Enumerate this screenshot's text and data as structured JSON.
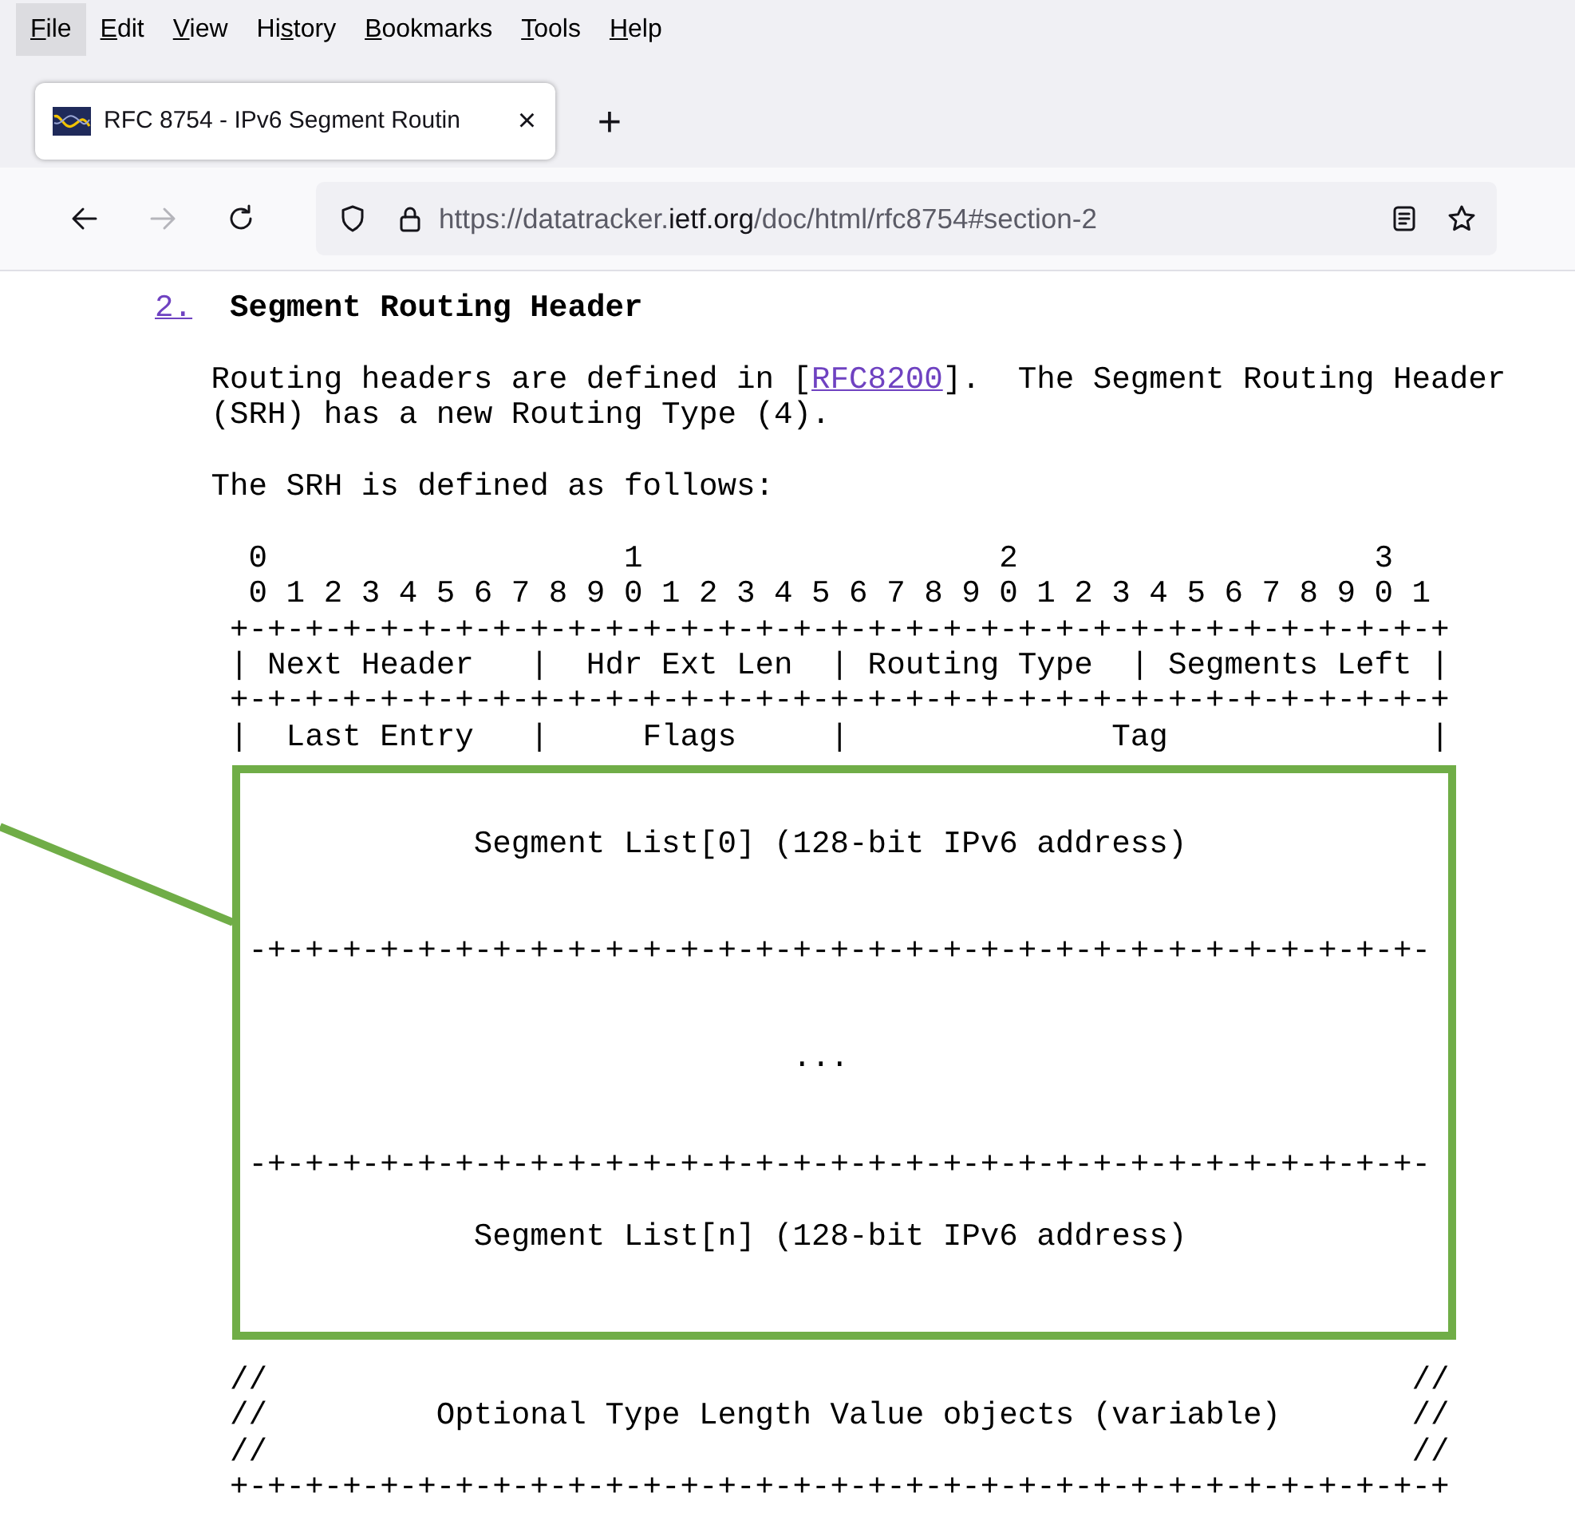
{
  "menu_bar": [
    {
      "key": "F",
      "after": "ile",
      "selected": true
    },
    {
      "key": "E",
      "after": "dit",
      "selected": false
    },
    {
      "key": "V",
      "after": "iew",
      "selected": false
    },
    {
      "before": "Hi",
      "key": "s",
      "after": "tory",
      "selected": false
    },
    {
      "key": "B",
      "after": "ookmarks",
      "selected": false
    },
    {
      "key": "T",
      "after": "ools",
      "selected": false
    },
    {
      "key": "H",
      "after": "elp",
      "selected": false
    }
  ],
  "tabs": [
    {
      "title": "RFC 8754 - IPv6 Segment Routin",
      "close": "×",
      "selected": true
    }
  ],
  "new_tab": "+",
  "nav": {
    "back_disabled": false,
    "forward_disabled": true,
    "url": {
      "prefix": "https://datatracker.",
      "domain": "ietf.org",
      "path": "/doc/html/rfc8754#section-2"
    }
  },
  "section": {
    "number": "2.",
    "title": "Segment Routing Header",
    "paragraphs": [
      {
        "lines": [
          {
            "before": "Routing headers are defined in [",
            "link": "RFC8200",
            "after": "].  The Segment Routing Header"
          },
          {
            "before": "(SRH) has a new Routing Type (4)."
          }
        ]
      },
      {
        "lines": [
          {
            "before": "The SRH is defined as follows:"
          }
        ]
      }
    ],
    "diagram": {
      "lines": [
        {
          "kind": "text",
          "text": " 0                   1                   2                   3"
        },
        {
          "kind": "text",
          "text": " 0 1 2 3 4 5 6 7 8 9 0 1 2 3 4 5 6 7 8 9 0 1 2 3 4 5 6 7 8 9 0 1"
        },
        {
          "kind": "text",
          "text": "+-+-+-+-+-+-+-+-+-+-+-+-+-+-+-+-+-+-+-+-+-+-+-+-+-+-+-+-+-+-+-+-+"
        },
        {
          "kind": "text",
          "text": "| Next Header   |  Hdr Ext Len  | Routing Type  | Segments Left |"
        },
        {
          "kind": "text",
          "text": "+-+-+-+-+-+-+-+-+-+-+-+-+-+-+-+-+-+-+-+-+-+-+-+-+-+-+-+-+-+-+-+-+"
        },
        {
          "kind": "text",
          "text": "|  Last Entry   |     Flags     |              Tag              |"
        },
        {
          "kind": "blank"
        },
        {
          "kind": "blank"
        },
        {
          "kind": "text",
          "text": "             Segment List[0] (128-bit IPv6 address)"
        },
        {
          "kind": "blank"
        },
        {
          "kind": "blank"
        },
        {
          "kind": "text",
          "text": " -+-+-+-+-+-+-+-+-+-+-+-+-+-+-+-+-+-+-+-+-+-+-+-+-+-+-+-+-+-+-+-"
        },
        {
          "kind": "blank"
        },
        {
          "kind": "blank"
        },
        {
          "kind": "text",
          "text": "                              ..."
        },
        {
          "kind": "blank"
        },
        {
          "kind": "blank"
        },
        {
          "kind": "text",
          "text": " -+-+-+-+-+-+-+-+-+-+-+-+-+-+-+-+-+-+-+-+-+-+-+-+-+-+-+-+-+-+-+-"
        },
        {
          "kind": "blank"
        },
        {
          "kind": "text",
          "text": "             Segment List[n] (128-bit IPv6 address)"
        },
        {
          "kind": "blank"
        },
        {
          "kind": "blank"
        },
        {
          "kind": "blank"
        },
        {
          "kind": "text",
          "text": "//                                                             //"
        },
        {
          "kind": "text",
          "text": "//         Optional Type Length Value objects (variable)       //"
        },
        {
          "kind": "text",
          "text": "//                                                             //"
        },
        {
          "kind": "text",
          "text": "+-+-+-+-+-+-+-+-+-+-+-+-+-+-+-+-+-+-+-+-+-+-+-+-+-+-+-+-+-+-+-+-+"
        }
      ]
    }
  },
  "annotation": {
    "color": "#70ad47"
  }
}
